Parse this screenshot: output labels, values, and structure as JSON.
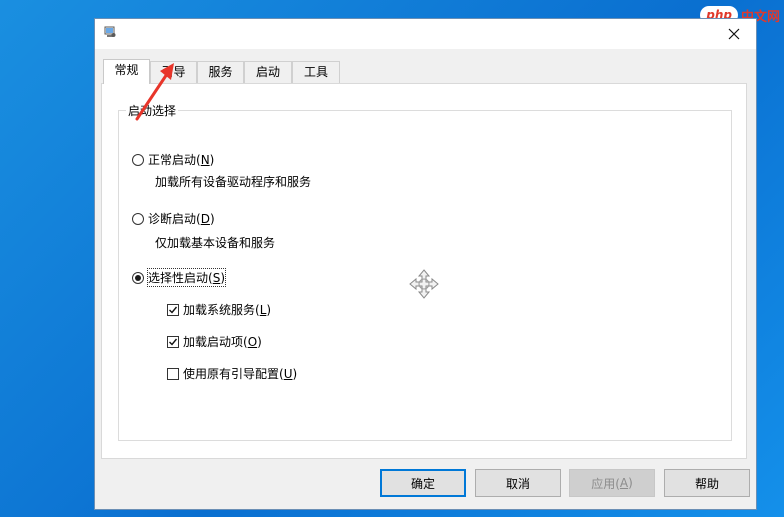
{
  "watermark": {
    "badge": "php",
    "text": "中文网"
  },
  "dialog": {
    "tabs": [
      {
        "label": "常规",
        "active": true
      },
      {
        "label": "引导",
        "active": false
      },
      {
        "label": "服务",
        "active": false
      },
      {
        "label": "启动",
        "active": false
      },
      {
        "label": "工具",
        "active": false
      }
    ],
    "group_title": "启动选择",
    "normal": {
      "text": "正常启动(",
      "key": "N",
      "end": ")",
      "desc": "加载所有设备驱动程序和服务",
      "selected": false
    },
    "diagnostic": {
      "text": "诊断启动(",
      "key": "D",
      "end": ")",
      "desc": "仅加载基本设备和服务",
      "selected": false
    },
    "selective": {
      "text": "选择性启动(",
      "key": "S",
      "end": ")",
      "selected": true
    },
    "checks": [
      {
        "text": "加载系统服务(",
        "key": "L",
        "end": ")",
        "checked": true
      },
      {
        "text": "加载启动项(",
        "key": "O",
        "end": ")",
        "checked": true
      },
      {
        "text": "使用原有引导配置(",
        "key": "U",
        "end": ")",
        "checked": false
      }
    ],
    "buttons": {
      "ok": "确定",
      "cancel": "取消",
      "apply_text": "应用(",
      "apply_key": "A",
      "apply_end": ")",
      "help": "帮助"
    }
  },
  "colors": {
    "annotation_arrow": "#e8352a",
    "accent": "#0078d7"
  }
}
